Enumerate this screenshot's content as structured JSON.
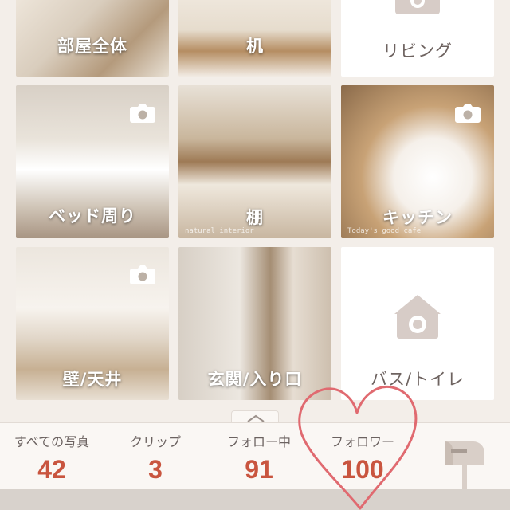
{
  "tiles": [
    {
      "label": "部屋全体"
    },
    {
      "label": "机"
    },
    {
      "label": "リビング"
    },
    {
      "label": "ベッド周り"
    },
    {
      "label": "棚",
      "watermark": "natural interior"
    },
    {
      "label": "キッチン",
      "watermark": "Today's good cafe"
    },
    {
      "label": "壁/天井"
    },
    {
      "label": "玄関/入り口"
    },
    {
      "label": "バス/トイレ"
    }
  ],
  "stats": {
    "all_photos": {
      "label": "すべての写真",
      "value": "42"
    },
    "clips": {
      "label": "クリップ",
      "value": "3"
    },
    "following": {
      "label": "フォロー中",
      "value": "91"
    },
    "followers": {
      "label": "フォロワー",
      "value": "100"
    }
  },
  "icons": {
    "camera": "camera-icon",
    "mailbox": "mailbox-icon",
    "handle": "chevron-up-icon",
    "heart": "heart-doodle"
  },
  "colors": {
    "accent": "#c9553f",
    "placeholder_icon": "#d7ccc7",
    "heart": "#e06a70"
  }
}
